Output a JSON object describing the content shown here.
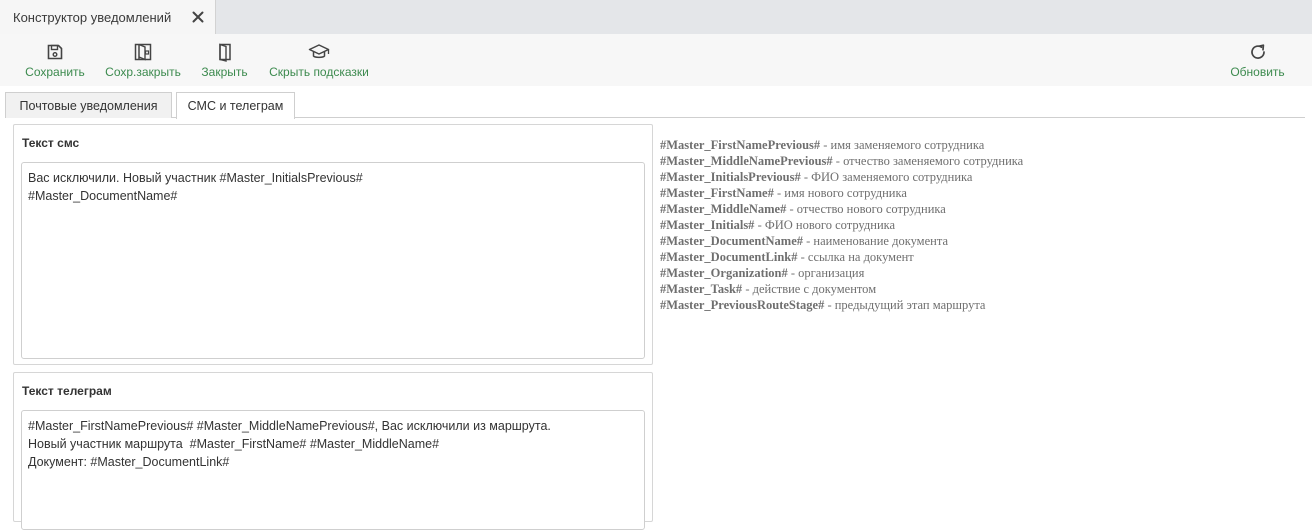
{
  "window": {
    "tab_title": "Конструктор уведомлений"
  },
  "toolbar": {
    "save_label": "Сохранить",
    "save_close_label": "Сохр.закрыть",
    "close_label": "Закрыть",
    "hide_hints_label": "Скрыть подсказки",
    "refresh_label": "Обновить",
    "accent_color": "#3c8a4e"
  },
  "tabs": [
    {
      "label": "Почтовые уведомления",
      "active": false
    },
    {
      "label": "СМС и телеграм",
      "active": true
    }
  ],
  "sms": {
    "title": "Текст смс",
    "text": "Вас исключили. Новый участник #Master_InitialsPrevious#\n#Master_DocumentName#"
  },
  "telegram": {
    "title": "Текст телеграм",
    "text": "#Master_FirstNamePrevious# #Master_MiddleNamePrevious#, Вас исключили из маршрута.\nНовый участник маршрута  #Master_FirstName# #Master_MiddleName#\nДокумент: #Master_DocumentLink#"
  },
  "hints": [
    {
      "key": "#Master_FirstNamePrevious#",
      "desc": " - имя заменяемого сотрудника"
    },
    {
      "key": "#Master_MiddleNamePrevious#",
      "desc": " - отчество заменяемого сотрудника"
    },
    {
      "key": "#Master_InitialsPrevious#",
      "desc": " - ФИО заменяемого сотрудника"
    },
    {
      "key": "#Master_FirstName#",
      "desc": " - имя нового сотрудника"
    },
    {
      "key": "#Master_MiddleName#",
      "desc": " - отчество нового сотрудника"
    },
    {
      "key": "#Master_Initials#",
      "desc": " - ФИО нового сотрудника"
    },
    {
      "key": "#Master_DocumentName#",
      "desc": " - наименование документа"
    },
    {
      "key": "#Master_DocumentLink#",
      "desc": " - ссылка на документ"
    },
    {
      "key": "#Master_Organization#",
      "desc": " - организация"
    },
    {
      "key": "#Master_Task#",
      "desc": " - действие с документом"
    },
    {
      "key": "#Master_PreviousRouteStage#",
      "desc": " - предыдущий этап маршрута"
    }
  ]
}
